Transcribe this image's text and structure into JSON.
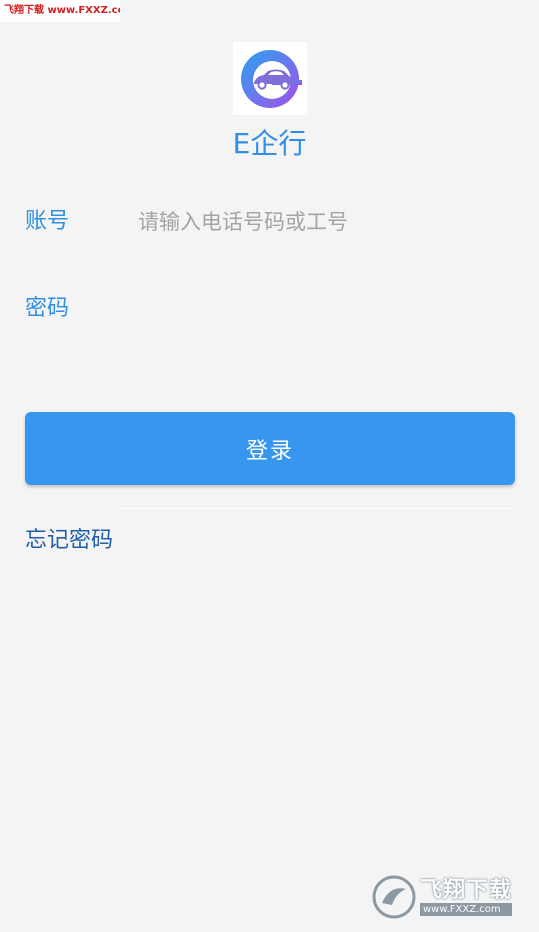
{
  "watermark": {
    "top_text": "飞翔下载 www.FXXZ.com",
    "bottom_cn": "飞翔下载",
    "bottom_url": "www.FXXZ.com"
  },
  "app": {
    "name": "E企行",
    "logo_icon": "car-e-logo-icon",
    "accent_color": "#2f8fe6"
  },
  "form": {
    "account_label": "账号",
    "account_placeholder": "请输入电话号码或工号",
    "account_value": "",
    "password_label": "密码",
    "password_placeholder": "",
    "password_value": ""
  },
  "actions": {
    "login_label": "登录",
    "forgot_label": "忘记密码",
    "button_color": "#3797ee"
  }
}
